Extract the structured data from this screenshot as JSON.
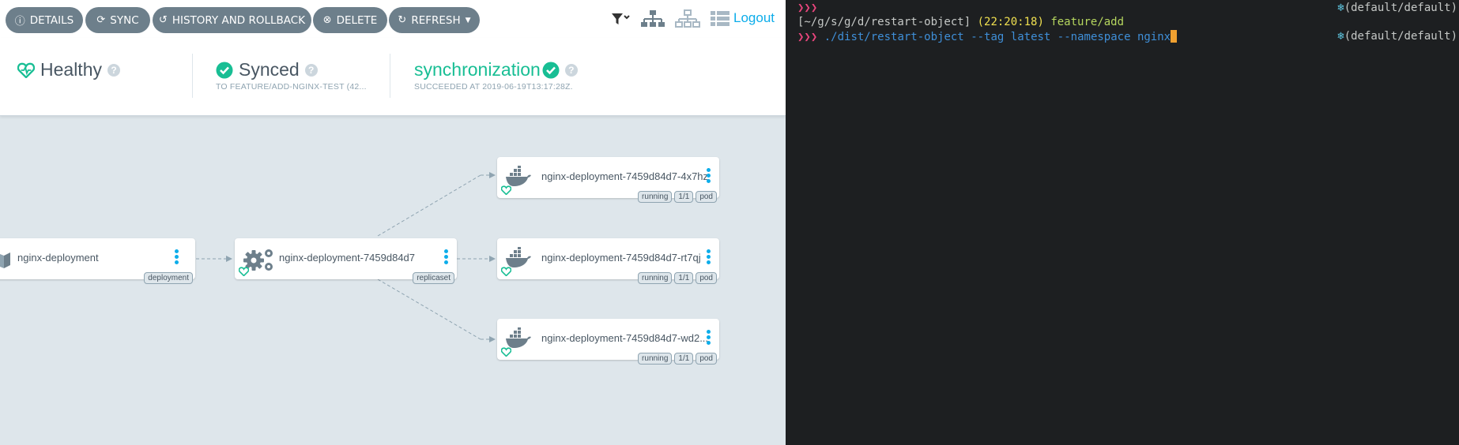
{
  "toolbar": {
    "buttons": [
      {
        "label": "DETAILS",
        "icon": "info-icon"
      },
      {
        "label": "SYNC",
        "icon": "sync-icon"
      },
      {
        "label": "HISTORY AND ROLLBACK",
        "icon": "history-icon"
      },
      {
        "label": "DELETE",
        "icon": "delete-icon"
      },
      {
        "label": "REFRESH",
        "icon": "refresh-icon"
      }
    ],
    "logout_label": "Logout"
  },
  "status": {
    "health": {
      "label": "Healthy",
      "icon": "heart-icon",
      "color": "#18be94"
    },
    "sync": {
      "label": "Synced",
      "sub": "TO FEATURE/ADD-NGINX-TEST (42...",
      "icon": "check-circle-icon"
    },
    "operation": {
      "label": "synchronization",
      "sub": "SUCCEEDED AT 2019-06-19T13:17:28Z.",
      "icon": "check-circle-icon"
    }
  },
  "graph": {
    "deployment": {
      "name": "nginx-deployment",
      "tags": [
        "deployment"
      ]
    },
    "replicaset": {
      "name": "nginx-deployment-7459d84d7",
      "tags": [
        "replicaset"
      ]
    },
    "pods": [
      {
        "name": "nginx-deployment-7459d84d7-4x7hz",
        "tags": [
          "running",
          "1/1",
          "pod"
        ]
      },
      {
        "name": "nginx-deployment-7459d84d7-rt7qj",
        "tags": [
          "running",
          "1/1",
          "pod"
        ]
      },
      {
        "name": "nginx-deployment-7459d84d7-wd2...",
        "tags": [
          "running",
          "1/1",
          "pod"
        ]
      }
    ]
  },
  "terminal": {
    "prompt": "❯❯❯",
    "cwd": "[~/g/s/g/d/restart-object]",
    "time": "(22:20:18)",
    "branch": "feature/add",
    "command": "./dist/restart-object",
    "arg1": "--tag",
    "arg1_value": "latest",
    "arg2": "--namespace",
    "arg2_value": "nginx",
    "context": "(default/default)",
    "context_icon": "kubernetes-icon"
  },
  "colors": {
    "accent": "#0dadea",
    "success": "#18be94",
    "button": "#6d7f8b",
    "terminal_bg": "#1d1f21"
  }
}
